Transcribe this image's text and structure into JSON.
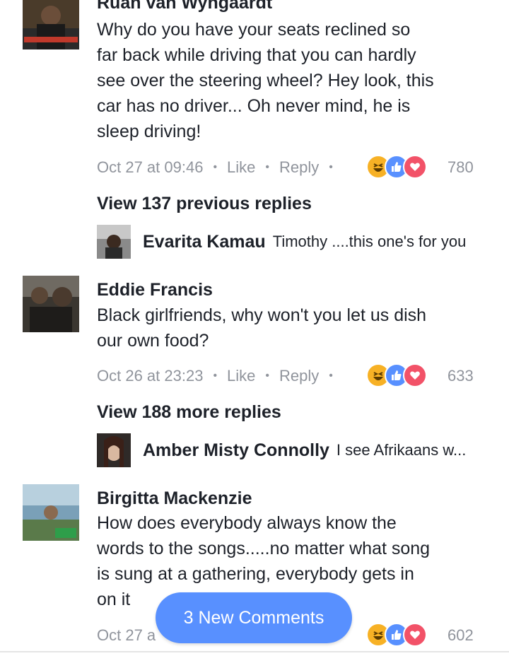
{
  "colors": {
    "text": "#1d2129",
    "meta": "#90949c",
    "pill": "#5890ff",
    "haha": "#f7b125",
    "like": "#5890ff",
    "love": "#f25268"
  },
  "comments": [
    {
      "author": "Ruan van Wyngaardt",
      "lines": [
        "Why do you  have your seats reclined so",
        "far back while driving that you can hardly",
        "see over the steering wheel? Hey look, this",
        "car has no driver... Oh never mind, he is",
        "sleep driving!"
      ],
      "time": "Oct 27 at 09:46",
      "like": "Like",
      "reply": "Reply",
      "reactions": [
        "haha-icon",
        "like-icon",
        "love-icon"
      ],
      "count": "780"
    },
    {
      "author": "Eddie Francis",
      "lines": [
        "Black girlfriends, why won't you let us dish",
        "our own food?"
      ],
      "time": "Oct 26 at 23:23",
      "like": "Like",
      "reply": "Reply",
      "reactions": [
        "haha-icon",
        "like-icon",
        "love-icon"
      ],
      "count": "633"
    },
    {
      "author": "Birgitta Mackenzie",
      "lines": [
        "How does everybody always know the",
        "words to the songs.....no matter what song",
        "is sung at a gathering, everybody gets in",
        "on it"
      ],
      "time": "Oct 27 a",
      "reactions": [
        "haha-icon",
        "like-icon",
        "love-icon"
      ],
      "count": "602"
    }
  ],
  "threads": [
    {
      "view_label": "View 137 previous replies",
      "reply_author": "Evarita Kamau",
      "reply_text": "Timothy ....this one's for you"
    },
    {
      "view_label": "View 188 more replies",
      "reply_author": "Amber Misty Connolly",
      "reply_text": "I see Afrikaans w..."
    }
  ],
  "new_comments_label": "3 New Comments"
}
